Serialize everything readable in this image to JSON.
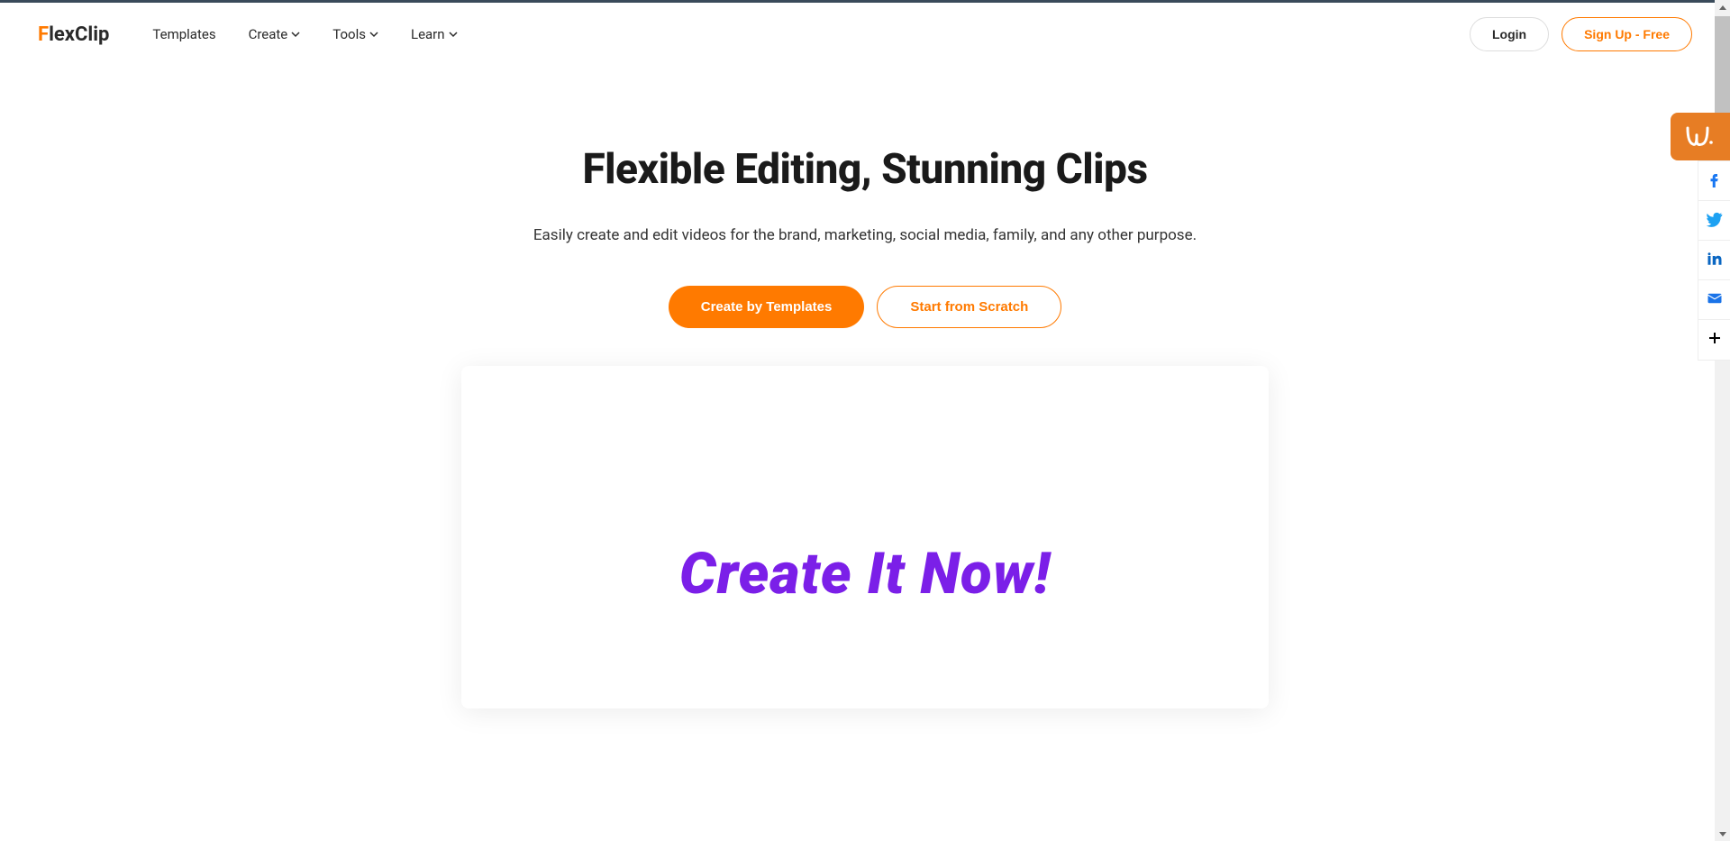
{
  "brand": {
    "first_letter": "F",
    "rest": "lexClip"
  },
  "nav": {
    "templates": "Templates",
    "create": "Create",
    "tools": "Tools",
    "learn": "Learn"
  },
  "header": {
    "login": "Login",
    "signup": "Sign Up - Free"
  },
  "hero": {
    "title": "Flexible Editing, Stunning Clips",
    "subtitle": "Easily create and edit videos for the brand, marketing, social media, family, and any other purpose.",
    "create_by_templates": "Create by Templates",
    "start_from_scratch": "Start from Scratch"
  },
  "video": {
    "overlay_text": "Create It Now!"
  },
  "social": {
    "facebook": "facebook",
    "twitter": "twitter",
    "linkedin": "linkedin",
    "email": "email",
    "more": "more"
  }
}
